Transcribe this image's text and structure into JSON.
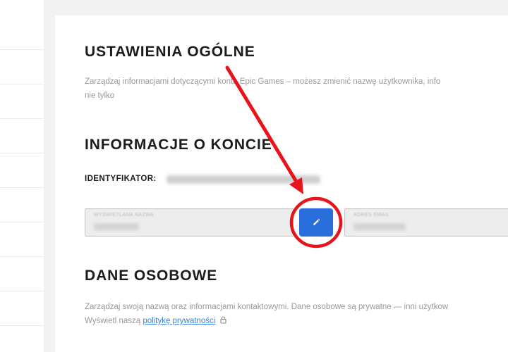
{
  "general_settings": {
    "title": "USTAWIENIA OGÓLNE",
    "description_line1": "Zarządzaj informacjami dotyczącymi konta Epic Games – możesz zmienić nazwę użytkownika, info",
    "description_line2": "nie tylko"
  },
  "account_info": {
    "title": "INFORMACJE O KONCIE",
    "id_label": "IDENTYFIKATOR:",
    "display_name_field": {
      "label": "WYŚWIETLANA NAZWA"
    },
    "email_field": {
      "label": "ADRES EMAIL"
    },
    "edit_button_icon": "pencil-icon"
  },
  "personal_data": {
    "title": "DANE OSOBOWE",
    "description_line1": "Zarządzaj swoją nazwą oraz informacjami kontaktowymi. Dane osobowe są prywatne — inni użytkow",
    "description_line2_prefix": "Wyświetl naszą",
    "privacy_link": "politykę prywatności",
    "lock_icon": "lock-icon"
  },
  "colors": {
    "accent_blue": "#2a6edb",
    "annotation_red": "#e8141b",
    "link_blue": "#3b82d8"
  }
}
